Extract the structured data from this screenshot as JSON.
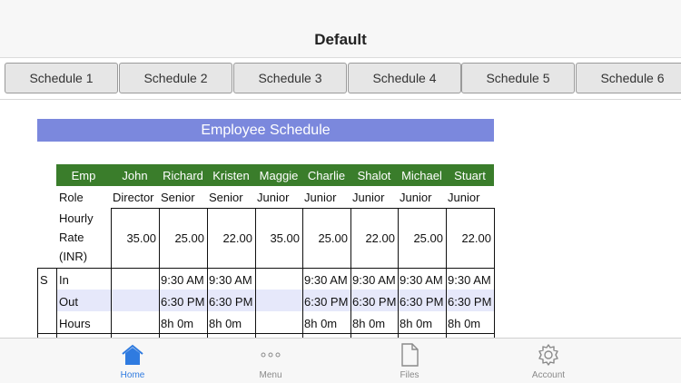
{
  "navbar": {
    "title": "Default"
  },
  "tabs": [
    "Schedule 1",
    "Schedule 2",
    "Schedule 3",
    "Schedule 4",
    "Schedule 5",
    "Schedule 6"
  ],
  "sheet": {
    "title": "Employee Schedule",
    "header_label": "Emp",
    "employees": [
      "John",
      "Richard",
      "Kristen",
      "Maggie",
      "Charlie",
      "Shalot",
      "Michael",
      "Stuart"
    ],
    "role_label": "Role",
    "roles": [
      "Director",
      "Senior",
      "Senior",
      "Junior",
      "Junior",
      "Junior",
      "Junior",
      "Junior"
    ],
    "rate_label_lines": [
      "Hourly",
      "Rate",
      "(INR)"
    ],
    "rates": [
      "35.00",
      "25.00",
      "22.00",
      "35.00",
      "25.00",
      "22.00",
      "25.00",
      "22.00"
    ],
    "day_label": "S",
    "time_rows": [
      {
        "label": "In",
        "values": [
          "",
          "9:30 AM",
          "9:30 AM",
          "",
          "9:30 AM",
          "9:30 AM",
          "9:30 AM",
          "9:30 AM"
        ]
      },
      {
        "label": "Out",
        "values": [
          "",
          "6:30 PM",
          "6:30 PM",
          "",
          "6:30 PM",
          "6:30 PM",
          "6:30 PM",
          "6:30 PM"
        ]
      },
      {
        "label": "Hours",
        "values": [
          "",
          "8h 0m",
          "8h 0m",
          "",
          "8h 0m",
          "8h 0m",
          "8h 0m",
          "8h 0m"
        ]
      }
    ],
    "colors": {
      "title_bg": "#7b88dd",
      "header_bg": "#3a7d2b",
      "band": "#e6e8fa"
    }
  },
  "tabbar": {
    "items": [
      {
        "label": "Home",
        "icon": "home-icon",
        "active": true
      },
      {
        "label": "Menu",
        "icon": "more-dots-icon",
        "active": false
      },
      {
        "label": "Files",
        "icon": "file-icon",
        "active": false
      },
      {
        "label": "Account",
        "icon": "gear-icon",
        "active": false
      }
    ],
    "active_color": "#2f7be0"
  }
}
